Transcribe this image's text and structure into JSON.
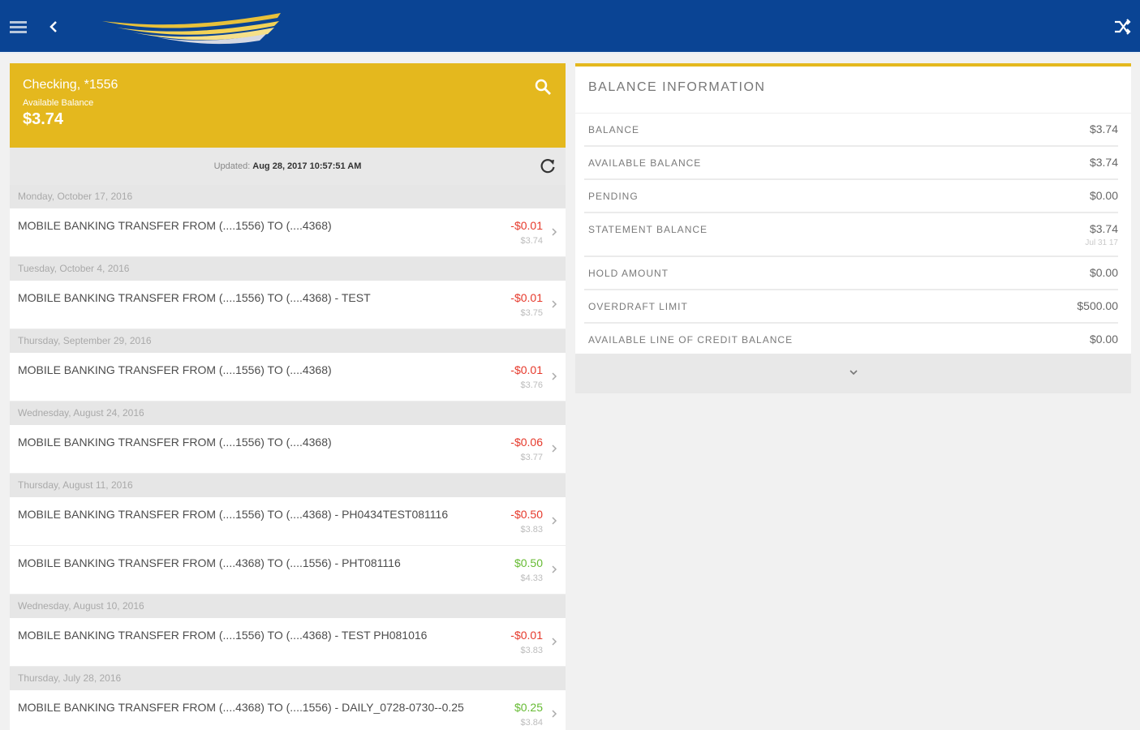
{
  "account": {
    "name": "Checking, *1556",
    "available_label": "Available Balance",
    "available_balance": "$3.74"
  },
  "updated": {
    "label": "Updated:",
    "value": "Aug 28, 2017 10:57:51 AM"
  },
  "transaction_groups": [
    {
      "date": "Monday, October 17, 2016",
      "transactions": [
        {
          "description": "MOBILE BANKING TRANSFER FROM (....1556) TO (....4368)",
          "amount": "-$0.01",
          "running_balance": "$3.74",
          "sign": "neg"
        }
      ]
    },
    {
      "date": "Tuesday, October 4, 2016",
      "transactions": [
        {
          "description": "MOBILE BANKING TRANSFER FROM (....1556) TO (....4368) - TEST",
          "amount": "-$0.01",
          "running_balance": "$3.75",
          "sign": "neg"
        }
      ]
    },
    {
      "date": "Thursday, September 29, 2016",
      "transactions": [
        {
          "description": "MOBILE BANKING TRANSFER FROM (....1556) TO (....4368)",
          "amount": "-$0.01",
          "running_balance": "$3.76",
          "sign": "neg"
        }
      ]
    },
    {
      "date": "Wednesday, August 24, 2016",
      "transactions": [
        {
          "description": "MOBILE BANKING TRANSFER FROM (....1556) TO (....4368)",
          "amount": "-$0.06",
          "running_balance": "$3.77",
          "sign": "neg"
        }
      ]
    },
    {
      "date": "Thursday, August 11, 2016",
      "transactions": [
        {
          "description": "MOBILE BANKING TRANSFER FROM (....1556) TO (....4368) - PH0434TEST081116",
          "amount": "-$0.50",
          "running_balance": "$3.83",
          "sign": "neg"
        },
        {
          "description": "MOBILE BANKING TRANSFER FROM (....4368) TO (....1556) - PHT081116",
          "amount": "$0.50",
          "running_balance": "$4.33",
          "sign": "pos"
        }
      ]
    },
    {
      "date": "Wednesday, August 10, 2016",
      "transactions": [
        {
          "description": "MOBILE BANKING TRANSFER FROM (....1556) TO (....4368) - TEST PH081016",
          "amount": "-$0.01",
          "running_balance": "$3.83",
          "sign": "neg"
        }
      ]
    },
    {
      "date": "Thursday, July 28, 2016",
      "transactions": [
        {
          "description": "MOBILE BANKING TRANSFER FROM (....4368) TO (....1556) - DAILY_0728-0730--0.25",
          "amount": "$0.25",
          "running_balance": "$3.84",
          "sign": "pos"
        }
      ]
    }
  ],
  "balance_info": {
    "title": "BALANCE INFORMATION",
    "rows": [
      {
        "label": "BALANCE",
        "value": "$3.74"
      },
      {
        "label": "AVAILABLE BALANCE",
        "value": "$3.74"
      },
      {
        "label": "PENDING",
        "value": "$0.00"
      },
      {
        "label": "STATEMENT BALANCE",
        "value": "$3.74",
        "sub": "Jul 31 17"
      },
      {
        "label": "HOLD AMOUNT",
        "value": "$0.00"
      },
      {
        "label": "OVERDRAFT LIMIT",
        "value": "$500.00"
      },
      {
        "label": "AVAILABLE LINE OF CREDIT BALANCE",
        "value": "$0.00"
      }
    ]
  },
  "colors": {
    "header_blue": "#0a4494",
    "accent_gold": "#e4b81e",
    "negative": "#e6392b",
    "positive": "#66bb33"
  },
  "icons": [
    "menu-icon",
    "back-icon",
    "shuffle-icon",
    "search-icon",
    "refresh-icon",
    "chevron-right-icon",
    "chevron-down-icon"
  ]
}
